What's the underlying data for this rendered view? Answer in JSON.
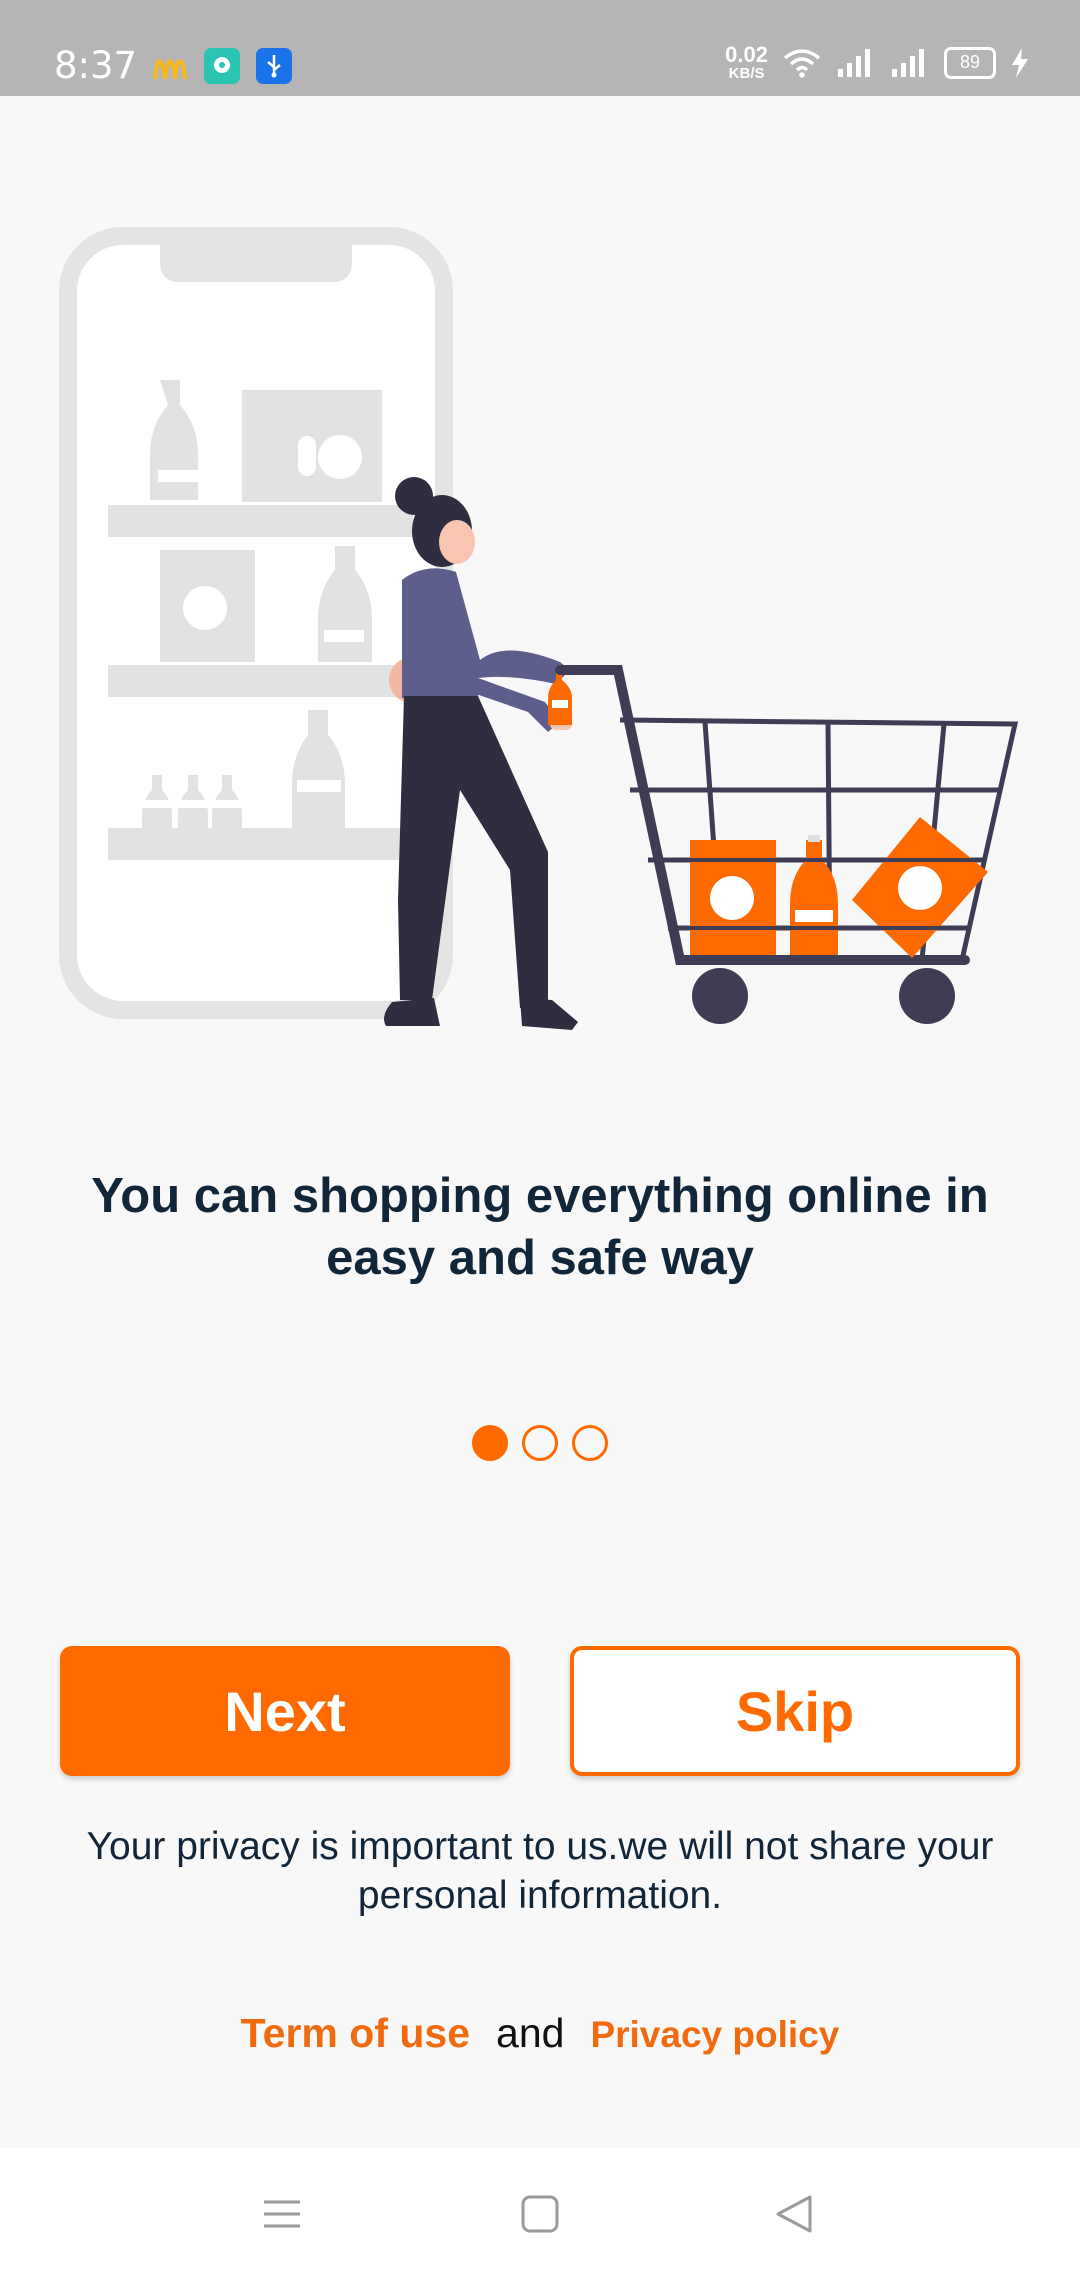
{
  "status_bar": {
    "time": "8:37",
    "net_speed_value": "0.02",
    "net_speed_unit": "KB/S",
    "battery": "89",
    "app_icons": [
      "mcdonalds-icon",
      "chat-icon",
      "usb-icon"
    ]
  },
  "onboarding": {
    "headline": "You can shopping everything online in easy and safe way",
    "page_indicator": {
      "count": 3,
      "active_index": 0
    },
    "next_label": "Next",
    "skip_label": "Skip",
    "privacy_note": "Your privacy is important to us.we will not share your personal information.",
    "terms_label": "Term of use",
    "and_label": "and",
    "privacy_policy_label": "Privacy policy"
  },
  "colors": {
    "accent": "#ff6a00",
    "headline": "#12263a",
    "background": "#f8f8f8",
    "status_bar": "#b5b5b5"
  },
  "nav_bar": {
    "icons": [
      "menu-icon",
      "home-square-icon",
      "back-triangle-icon"
    ]
  }
}
